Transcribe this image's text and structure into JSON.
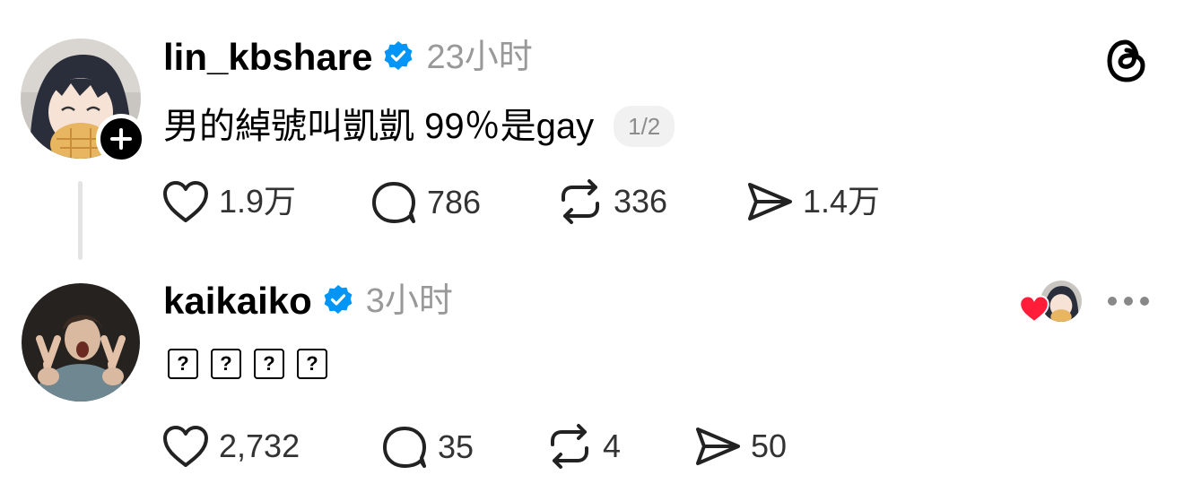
{
  "post1": {
    "username": "lin_kbshare",
    "time": "23小时",
    "text": "男的綽號叫凱凱 99％是gay",
    "pager": "1/2",
    "metrics": {
      "likes": "1.9万",
      "replies": "786",
      "reposts": "336",
      "shares": "1.4万"
    }
  },
  "post2": {
    "username": "kaikaiko",
    "time": "3小时",
    "emoji_glyph": "?",
    "metrics": {
      "likes": "2,732",
      "replies": "35",
      "reposts": "4",
      "shares": "50"
    }
  },
  "icons": [
    "threads-logo-icon",
    "verified-badge-icon",
    "follow-plus-icon",
    "heart-icon",
    "comment-icon",
    "repost-icon",
    "share-icon",
    "more-icon",
    "liked-heart-icon"
  ],
  "colors": {
    "verified": "#0095f6",
    "liked": "#ff1d3a",
    "muted": "#999999"
  }
}
